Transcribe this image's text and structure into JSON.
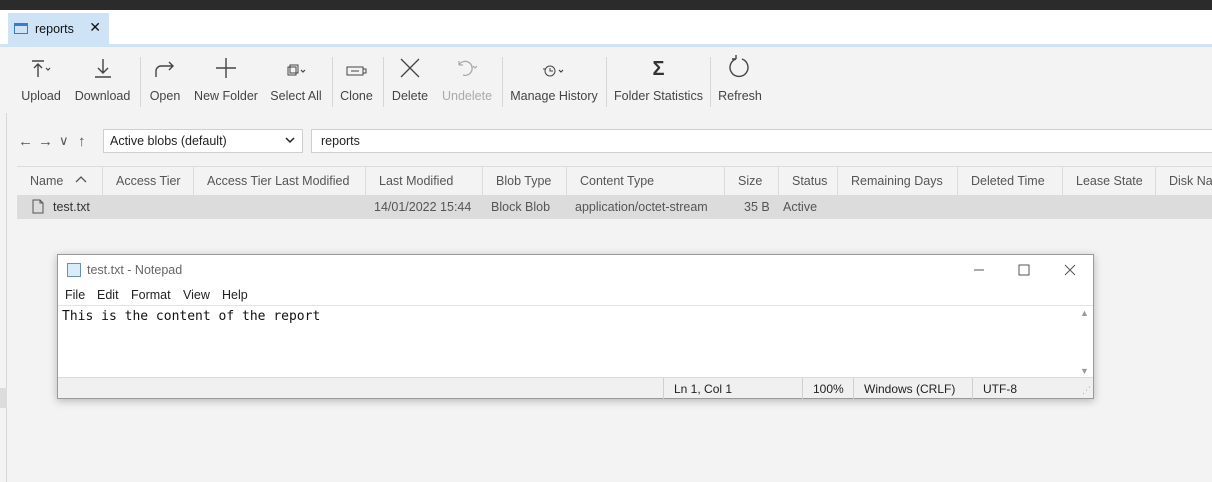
{
  "tab": {
    "label": "reports",
    "close": "✕"
  },
  "toolbar": {
    "items": [
      {
        "label": "Upload"
      },
      {
        "label": "Download"
      },
      {
        "label": "Open"
      },
      {
        "label": "New Folder"
      },
      {
        "label": "Select All"
      },
      {
        "label": "Clone"
      },
      {
        "label": "Delete"
      },
      {
        "label": "Undelete"
      },
      {
        "label": "Manage History"
      },
      {
        "label": "Folder Statistics"
      },
      {
        "label": "Refresh"
      }
    ]
  },
  "nav": {
    "back": "←",
    "forward": "→",
    "recent": "∨",
    "up": "↑",
    "filter": {
      "selected": "Active blobs (default)"
    },
    "path": "reports"
  },
  "grid": {
    "columns": [
      "Name",
      "Access Tier",
      "Access Tier Last Modified",
      "Last Modified",
      "Blob Type",
      "Content Type",
      "Size",
      "Status",
      "Remaining Days",
      "Deleted Time",
      "Lease State",
      "Disk Nam"
    ],
    "rows": [
      {
        "name": "test.txt",
        "last_modified": "14/01/2022 15:44",
        "blob_type": "Block Blob",
        "content_type": "application/octet-stream",
        "size": "35 B",
        "status": "Active"
      }
    ]
  },
  "notepad": {
    "title": "test.txt - Notepad",
    "menu": [
      "File",
      "Edit",
      "Format",
      "View",
      "Help"
    ],
    "content": "This is the content of the report",
    "status": {
      "position": "Ln 1, Col 1",
      "zoom": "100%",
      "line_endings": "Windows (CRLF)",
      "encoding": "UTF-8"
    }
  }
}
